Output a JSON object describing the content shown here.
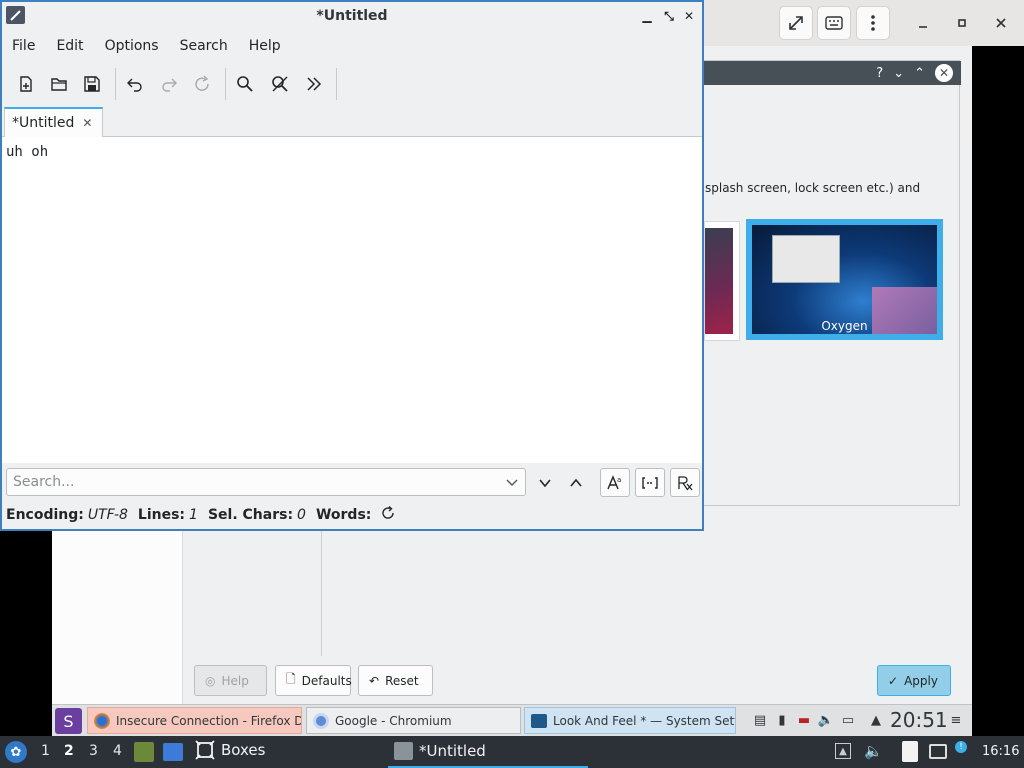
{
  "host_toolbar": {
    "icons": [
      "fullscreen-icon",
      "keyboard-icon",
      "kebab-menu-icon",
      "minimize-icon",
      "maximize-icon",
      "close-icon"
    ]
  },
  "featherpad": {
    "title": "*Untitled",
    "menu": [
      "File",
      "Edit",
      "Options",
      "Search",
      "Help"
    ],
    "tab_label": "*Untitled",
    "editor_text": "uh oh",
    "search_placeholder": "Search...",
    "status": {
      "encoding_label": "Encoding:",
      "encoding_value": "UTF-8",
      "lines_label": "Lines:",
      "lines_value": "1",
      "sel_label": "Sel. Chars:",
      "sel_value": "0",
      "words_label": "Words:"
    }
  },
  "settings": {
    "description": "splash screen, lock screen etc.) and",
    "theme_label": "Oxygen",
    "buttons": {
      "help": "Help",
      "defaults": "Defaults",
      "reset": "Reset",
      "apply": "Apply"
    }
  },
  "guest_taskbar": {
    "tasks": [
      "Insecure Connection - Firefox De",
      "Google - Chromium",
      "Look And Feel * — System Settin"
    ],
    "clock": "20:51"
  },
  "host_taskbar": {
    "desktops": [
      "1",
      "2",
      "3",
      "4"
    ],
    "active_desktop": "2",
    "boxes_label": "Boxes",
    "task_label": "*Untitled",
    "clock": "16:16"
  }
}
